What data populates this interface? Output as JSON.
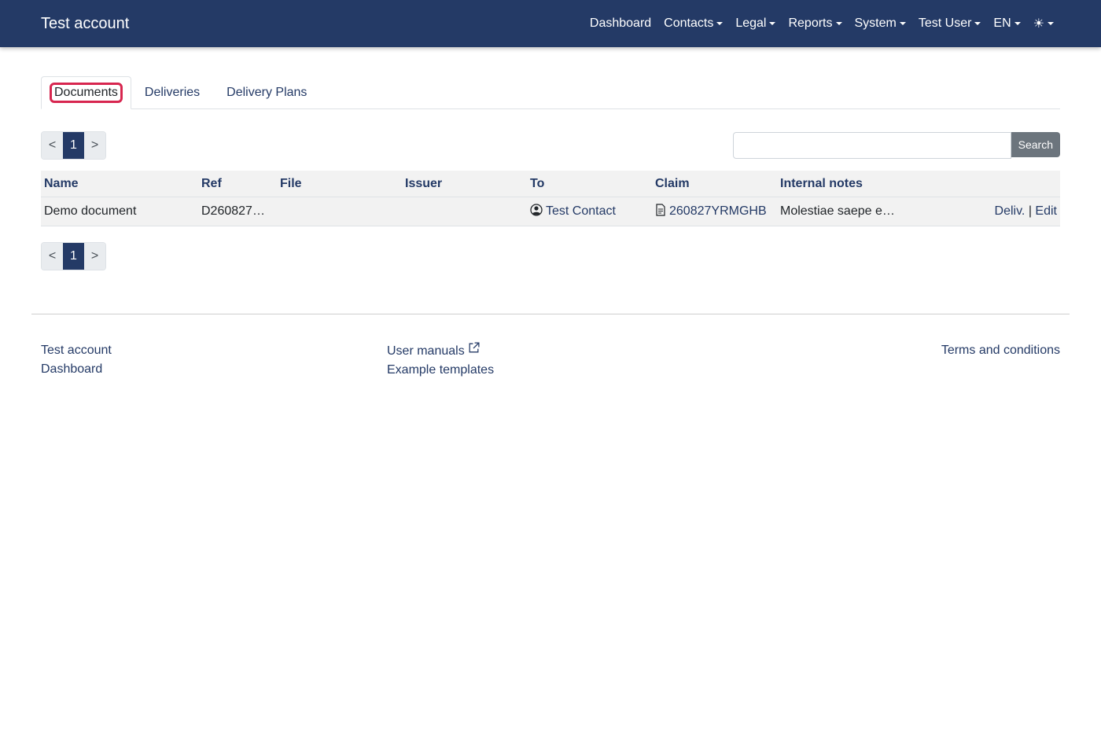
{
  "navbar": {
    "brand": "Test account",
    "items": [
      {
        "label": "Dashboard",
        "dropdown": false
      },
      {
        "label": "Contacts",
        "dropdown": true
      },
      {
        "label": "Legal",
        "dropdown": true
      },
      {
        "label": "Reports",
        "dropdown": true
      },
      {
        "label": "System",
        "dropdown": true
      },
      {
        "label": "Test User",
        "dropdown": true
      },
      {
        "label": "EN",
        "dropdown": true
      }
    ],
    "theme_icon": "☀"
  },
  "tabs": [
    {
      "label": "Documents",
      "active": true
    },
    {
      "label": "Deliveries",
      "active": false
    },
    {
      "label": "Delivery Plans",
      "active": false
    }
  ],
  "pagination": {
    "prev": "<",
    "current": "1",
    "next": ">"
  },
  "search": {
    "value": "",
    "button_label": "Search"
  },
  "table": {
    "columns": [
      "Name",
      "Ref",
      "File",
      "Issuer",
      "To",
      "Claim",
      "Internal notes",
      ""
    ],
    "rows": [
      {
        "name": "Demo document",
        "ref": "D260827…",
        "file": "",
        "issuer": "",
        "to": "Test Contact",
        "claim": "260827YRMGHB",
        "notes": "Molestiae saepe e…",
        "action_deliv": "Deliv.",
        "action_sep": "|",
        "action_edit": "Edit"
      }
    ]
  },
  "footer": {
    "col1": [
      "Test account",
      "Dashboard"
    ],
    "col2": [
      "User manuals",
      "Example templates"
    ],
    "col3": [
      "Terms and conditions"
    ]
  },
  "colors": {
    "primary": "#243a66",
    "focus_ring": "#d7264f",
    "button_gray": "#6c757d"
  }
}
